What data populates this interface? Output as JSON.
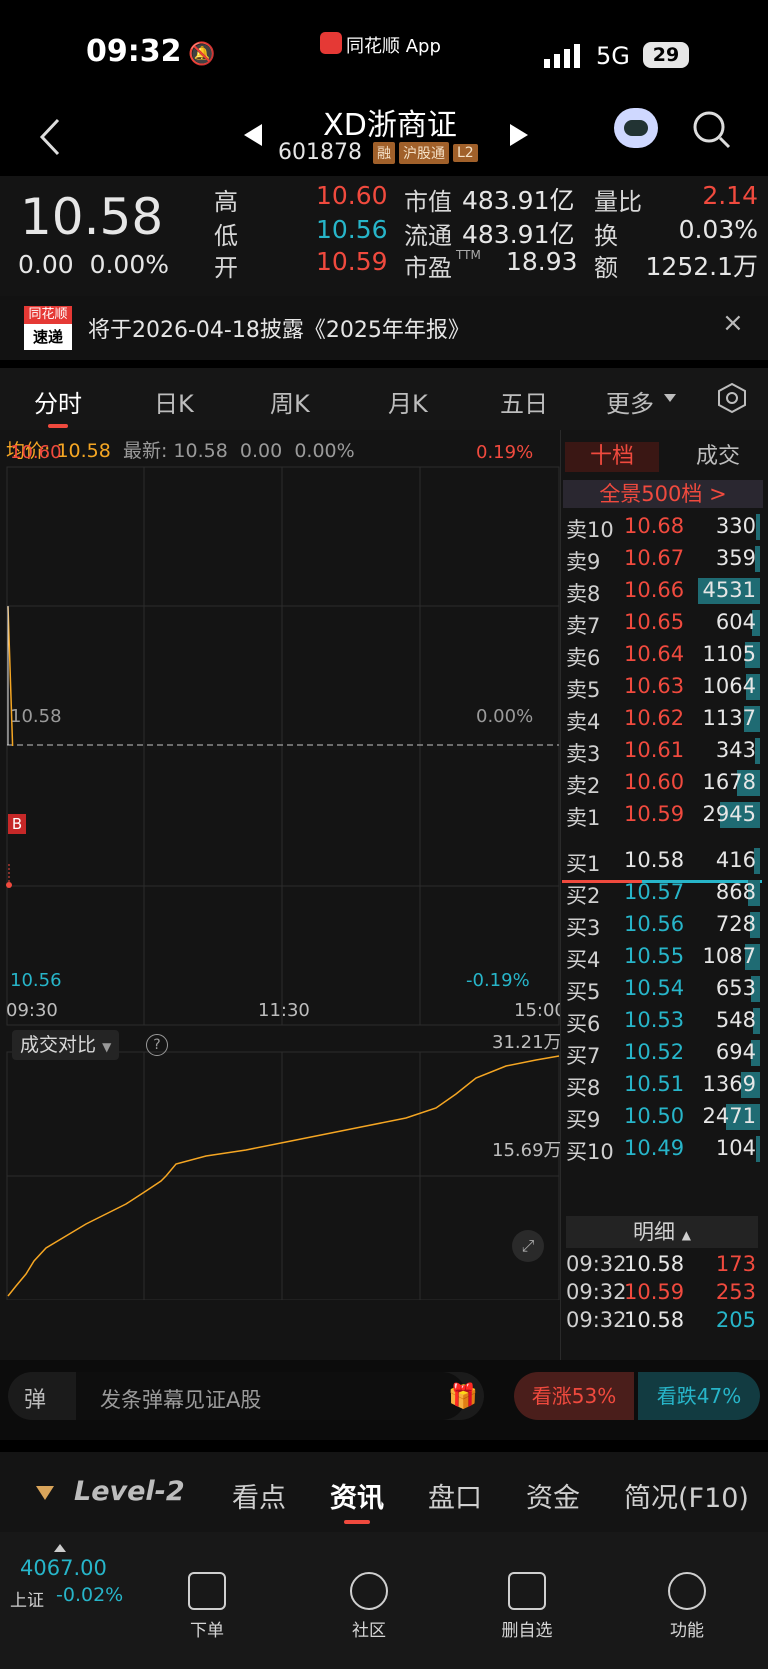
{
  "status": {
    "time": "09:32",
    "center_app": "同花顺 App",
    "network": "5G",
    "battery": "29"
  },
  "header": {
    "title": "XD浙商证",
    "code": "601878",
    "tags": [
      "融",
      "沪股通",
      "L2"
    ]
  },
  "quote": {
    "price": "10.58",
    "change": "0.00",
    "change_pct": "0.00%",
    "high_label": "高",
    "high": "10.60",
    "low_label": "低",
    "low": "10.56",
    "open_label": "开",
    "open": "10.59",
    "mktcap_label": "市值",
    "mktcap": "483.91亿",
    "float_label": "流通",
    "float": "483.91亿",
    "pe_label": "市盈",
    "pe_sup": "TTM",
    "pe": "18.93",
    "volratio_label": "量比",
    "volratio": "2.14",
    "turnover_label": "换",
    "turnover": "0.03%",
    "amount_label": "额",
    "amount": "1252.1万"
  },
  "notice": {
    "badge_top": "同花顺",
    "badge_bottom": "速递",
    "text": "将于2026-04-18披露《2025年年报》"
  },
  "tabs": [
    "分时",
    "日K",
    "周K",
    "月K",
    "五日",
    "更多"
  ],
  "info_line": {
    "avg_label": "均价:",
    "avg": "10.58",
    "latest_label": "最新:",
    "latest": "10.58",
    "chg": "0.00",
    "pct": "0.00%"
  },
  "chart": {
    "y_top": "10.60",
    "y_top_pct": "0.19%",
    "y_mid": "10.58",
    "y_mid_pct": "0.00%",
    "y_bot": "10.56",
    "y_bot_pct": "-0.19%",
    "x_labels": [
      "09:30",
      "11:30",
      "15:00"
    ],
    "marker": "B",
    "vol_selector": "成交对比",
    "vol_top": "31.21万",
    "vol_mid": "15.69万"
  },
  "chart_data": {
    "type": "line",
    "x": [
      "09:30",
      "09:31",
      "09:32"
    ],
    "price": [
      10.59,
      10.585,
      10.58
    ],
    "ylim": [
      10.56,
      10.6
    ]
  },
  "orderbook": {
    "tab_active": "十档",
    "tab_other": "成交",
    "panorama": "全景500档 >",
    "asks": [
      {
        "label": "卖10",
        "price": "10.68",
        "vol": "330",
        "bar": 0.07
      },
      {
        "label": "卖9",
        "price": "10.67",
        "vol": "359",
        "bar": 0.08
      },
      {
        "label": "卖8",
        "price": "10.66",
        "vol": "4531",
        "bar": 1.0
      },
      {
        "label": "卖7",
        "price": "10.65",
        "vol": "604",
        "bar": 0.13
      },
      {
        "label": "卖6",
        "price": "10.64",
        "vol": "1105",
        "bar": 0.24
      },
      {
        "label": "卖5",
        "price": "10.63",
        "vol": "1064",
        "bar": 0.23
      },
      {
        "label": "卖4",
        "price": "10.62",
        "vol": "1137",
        "bar": 0.25
      },
      {
        "label": "卖3",
        "price": "10.61",
        "vol": "343",
        "bar": 0.08
      },
      {
        "label": "卖2",
        "price": "10.60",
        "vol": "1678",
        "bar": 0.37
      },
      {
        "label": "卖1",
        "price": "10.59",
        "vol": "2945",
        "bar": 0.65
      }
    ],
    "bids": [
      {
        "label": "买1",
        "price": "10.58",
        "vol": "416",
        "bar": 0.09
      },
      {
        "label": "买2",
        "price": "10.57",
        "vol": "868",
        "bar": 0.19
      },
      {
        "label": "买3",
        "price": "10.56",
        "vol": "728",
        "bar": 0.16
      },
      {
        "label": "买4",
        "price": "10.55",
        "vol": "1087",
        "bar": 0.24
      },
      {
        "label": "买5",
        "price": "10.54",
        "vol": "653",
        "bar": 0.14
      },
      {
        "label": "买6",
        "price": "10.53",
        "vol": "548",
        "bar": 0.12
      },
      {
        "label": "买7",
        "price": "10.52",
        "vol": "694",
        "bar": 0.15
      },
      {
        "label": "买8",
        "price": "10.51",
        "vol": "1369",
        "bar": 0.3
      },
      {
        "label": "买9",
        "price": "10.50",
        "vol": "2471",
        "bar": 0.55
      },
      {
        "label": "买10",
        "price": "10.49",
        "vol": "104",
        "bar": 0.02
      }
    ],
    "detail_label": "明细",
    "trades": [
      {
        "time": "09:32",
        "price": "10.58",
        "vol": "173"
      },
      {
        "time": "09:32",
        "price": "10.59",
        "vol": "253"
      },
      {
        "time": "09:32",
        "price": "10.58",
        "vol": "205"
      }
    ]
  },
  "danmu": {
    "icon": "弹",
    "placeholder": "发条弹幕见证A股",
    "up": "看涨53%",
    "down": "看跌47%"
  },
  "bottom_tabs": [
    "Level-2",
    "看点",
    "资讯",
    "盘口",
    "资金",
    "简况(F10)"
  ],
  "nav": {
    "index_value": "4067.00",
    "index_name": "上证",
    "index_pct": "-0.02%",
    "items": [
      "下单",
      "社区",
      "删自选",
      "功能"
    ]
  },
  "colors": {
    "up": "#f04a3e",
    "down": "#27b5c9",
    "accent": "#f5a623"
  }
}
